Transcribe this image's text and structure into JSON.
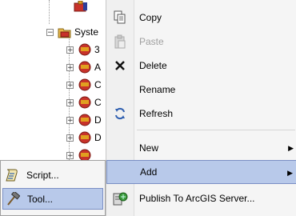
{
  "tree": {
    "root_item": {
      "label": "Syste"
    },
    "children": [
      {
        "label": "3"
      },
      {
        "label": "A"
      },
      {
        "label": "C"
      },
      {
        "label": "C"
      },
      {
        "label": "D"
      },
      {
        "label": "D"
      },
      {
        "label": ""
      },
      {
        "label": ""
      },
      {
        "label": ""
      }
    ]
  },
  "context_menu": {
    "items": [
      {
        "label": "Copy",
        "icon": "copy-icon",
        "disabled": false
      },
      {
        "label": "Paste",
        "icon": "paste-icon",
        "disabled": true
      },
      {
        "label": "Delete",
        "icon": "delete-icon",
        "disabled": false
      },
      {
        "label": "Rename",
        "icon": "",
        "disabled": false
      },
      {
        "label": "Refresh",
        "icon": "refresh-icon",
        "disabled": false
      },
      {
        "label": "New",
        "icon": "",
        "disabled": false,
        "submenu_arrow": "▶"
      },
      {
        "label": "Add",
        "icon": "",
        "disabled": false,
        "submenu_arrow": "▶",
        "highlighted": true
      },
      {
        "label": "Publish To ArcGIS Server...",
        "icon": "publish-server-icon",
        "disabled": false
      }
    ]
  },
  "add_submenu": {
    "items": [
      {
        "label": "Script...",
        "icon": "script-icon"
      },
      {
        "label": "Tool...",
        "icon": "hammer-tool-icon",
        "highlighted": true
      }
    ]
  },
  "colors": {
    "highlight_fill": "#b8c9ea",
    "highlight_border": "#7a8fc4",
    "menu_background": "#f5f5f5",
    "disabled_text": "#a0a0a0"
  }
}
